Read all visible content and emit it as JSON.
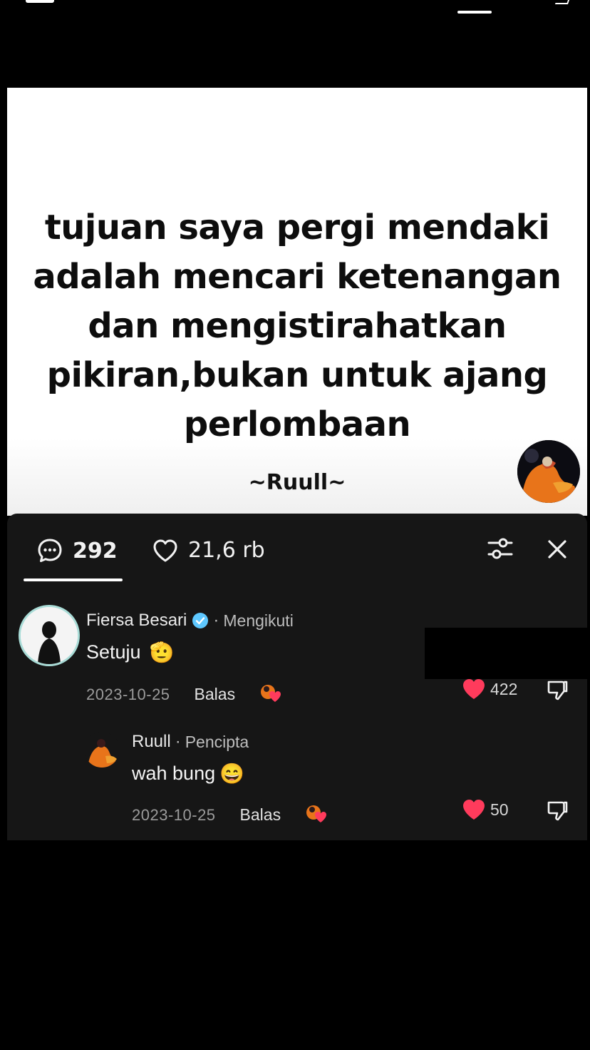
{
  "post": {
    "quote": "tujuan saya pergi mendaki adalah mencari ketenangan dan mengistirahatkan pikiran,bukan untuk ajang perlombaan",
    "author_tag": "~Ruull~"
  },
  "panel": {
    "comment_count": "292",
    "like_count": "21,6 rb"
  },
  "comments": [
    {
      "username": "Fiersa Besari",
      "verified": true,
      "separator": "·",
      "relation": "Mengikuti",
      "text": "Setuju",
      "emoji": "🫡",
      "date": "2023-10-25",
      "reply_label": "Balas",
      "likes": "422"
    },
    {
      "username": "Ruull",
      "separator": "·",
      "relation": "Pencipta",
      "text": "wah bung",
      "emoji": "😄",
      "date": "2023-10-25",
      "reply_label": "Balas",
      "likes": "50"
    }
  ],
  "colors": {
    "panel_bg": "#161616",
    "heart": "#ff3b5c",
    "verified": "#5ec8ff",
    "avatar_ring": "#a9dcd7"
  },
  "icons": [
    "comment-bubble-icon",
    "heart-outline-icon",
    "filter-sliders-icon",
    "close-icon",
    "verified-badge-icon",
    "heart-filled-icon",
    "dislike-icon"
  ]
}
